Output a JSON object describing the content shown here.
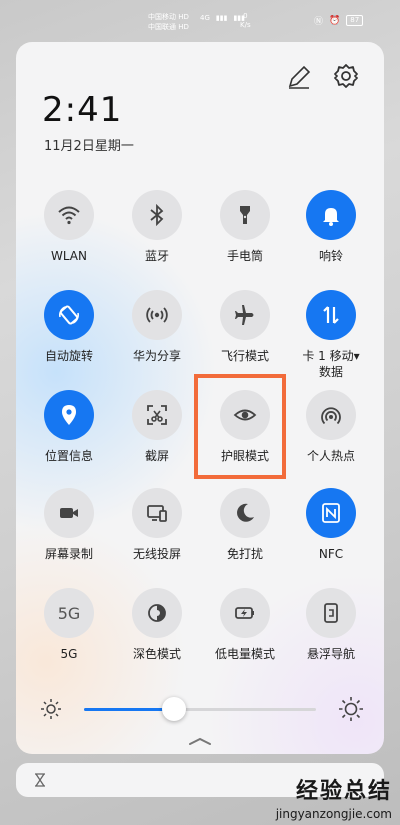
{
  "status_bar": {
    "carrier1": "中国移动 HD",
    "carrier2": "中国联通 HD",
    "signal": "4G",
    "speed_value": "0",
    "speed_unit": "K/s",
    "battery": "87"
  },
  "panel": {
    "time": "2:41",
    "date": "11月2日星期一"
  },
  "tiles": [
    {
      "label": "WLAN",
      "icon": "wifi-icon",
      "on": false
    },
    {
      "label": "蓝牙",
      "icon": "bluetooth-icon",
      "on": false
    },
    {
      "label": "手电筒",
      "icon": "flashlight-icon",
      "on": false
    },
    {
      "label": "响铃",
      "icon": "bell-icon",
      "on": true
    },
    {
      "label": "自动旋转",
      "icon": "rotate-icon",
      "on": true
    },
    {
      "label": "华为分享",
      "icon": "share-icon",
      "on": false
    },
    {
      "label": "飞行模式",
      "icon": "airplane-icon",
      "on": false
    },
    {
      "label": "卡 1 移动▾",
      "label2": "数据",
      "icon": "mobile-data-icon",
      "on": true
    },
    {
      "label": "位置信息",
      "icon": "location-icon",
      "on": true
    },
    {
      "label": "截屏",
      "icon": "screenshot-icon",
      "on": false
    },
    {
      "label": "护眼模式",
      "icon": "eye-icon",
      "on": false
    },
    {
      "label": "个人热点",
      "icon": "hotspot-icon",
      "on": false
    },
    {
      "label": "屏幕录制",
      "icon": "video-icon",
      "on": false
    },
    {
      "label": "无线投屏",
      "icon": "cast-icon",
      "on": false
    },
    {
      "label": "免打扰",
      "icon": "moon-icon",
      "on": false
    },
    {
      "label": "NFC",
      "icon": "nfc-icon",
      "on": true
    },
    {
      "label": "5G",
      "icon_text": "5G",
      "icon": "5g-icon",
      "on": false
    },
    {
      "label": "深色模式",
      "icon": "dark-mode-icon",
      "on": false
    },
    {
      "label": "低电量模式",
      "icon": "battery-saver-icon",
      "on": false
    },
    {
      "label": "悬浮导航",
      "icon": "float-nav-icon",
      "on": false
    }
  ],
  "brightness": {
    "level": 0.39
  },
  "colors": {
    "accent": "#1677f2",
    "highlight": "#f26b3a"
  },
  "watermark": {
    "title": "经验总结",
    "url": "jingyanzongjie.com"
  }
}
